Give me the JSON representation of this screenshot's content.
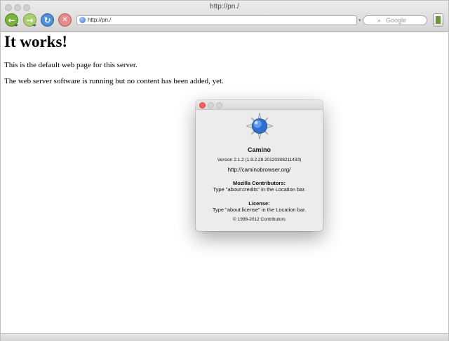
{
  "window": {
    "title": "http://pn./"
  },
  "toolbar": {
    "back_icon": "back-arrow-icon",
    "forward_icon": "forward-arrow-icon",
    "reload_icon": "reload-icon",
    "stop_icon": "stop-icon",
    "url": "http://pn./",
    "search_placeholder": "Google",
    "bookmarks_icon": "bookmarks-icon"
  },
  "page": {
    "heading": "It works!",
    "paragraphs": [
      "This is the default web page for this server.",
      "The web server software is running but no content has been added, yet."
    ]
  },
  "about_dialog": {
    "app_name": "Camino",
    "version": "Version 2.1.2 (1.9.2.28 20120308211433)",
    "website": "http://caminobrowser.org/",
    "contributors_heading": "Mozilla Contributors:",
    "contributors_text": "Type \"about:credits\" in the Location bar.",
    "license_heading": "License:",
    "license_text": "Type \"about:license\" in the Location bar.",
    "copyright": "© 1998-2012 Contributors"
  },
  "colors": {
    "back": "#7bb33a",
    "forward": "#a9cf6e",
    "reload": "#4f8fd6",
    "stop": "#e48c8c",
    "close_red": "#fc605b"
  }
}
